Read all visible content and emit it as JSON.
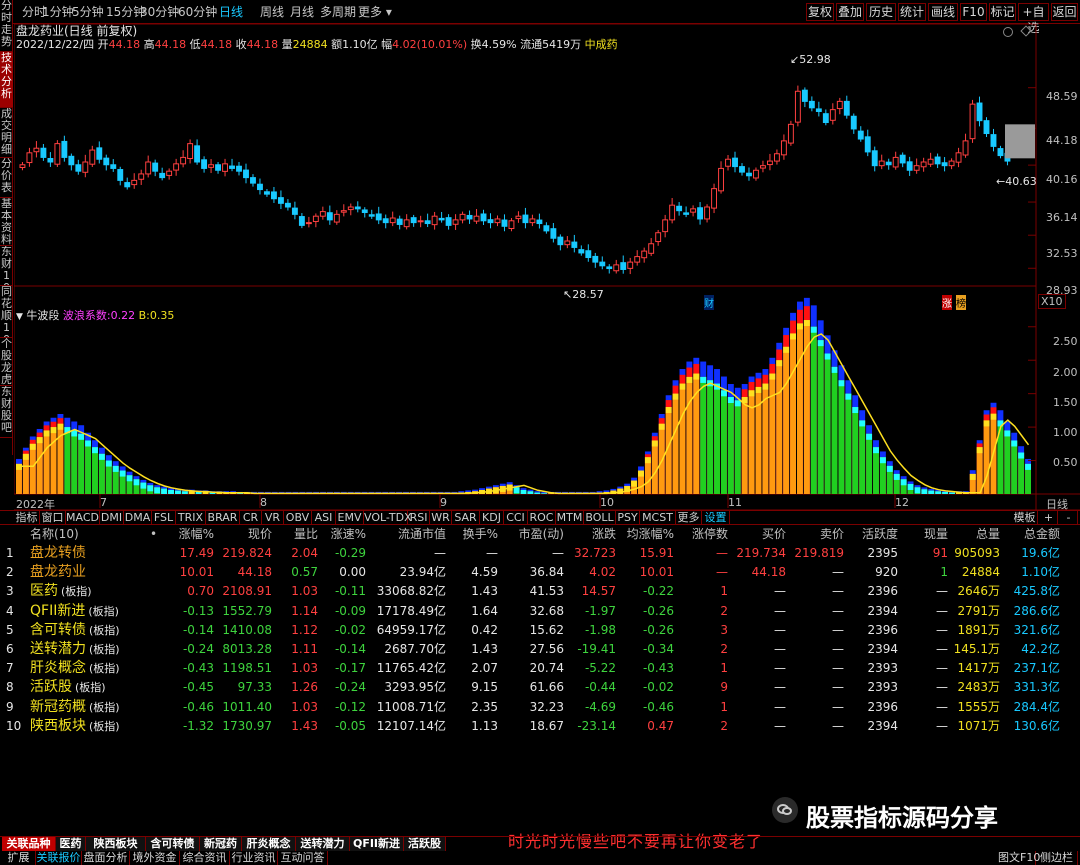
{
  "toolbar": {
    "periods": [
      "分时",
      "1分钟",
      "5分钟",
      "15分钟",
      "30分钟",
      "60分钟",
      "日线",
      "周线",
      "月线",
      "多周期",
      "更多"
    ],
    "active_period": "日线",
    "buttons": [
      "复权",
      "叠加",
      "历史",
      "统计",
      "画线",
      "F10",
      "标记",
      "+自选",
      "返回"
    ]
  },
  "sidebar": {
    "tabs": [
      "分时走势",
      "技术分析",
      "成交明细",
      "分价表",
      "基本资料",
      "东财10",
      "同花顺10",
      "个股龙虎",
      "东财股吧"
    ],
    "active": "技术分析"
  },
  "header": {
    "title": "盘龙药业(日线 前复权)",
    "date": "2022/12/22/四",
    "open_label": "开",
    "open": "44.18",
    "high_label": "高",
    "high": "44.18",
    "low_label": "低",
    "low": "44.18",
    "close_label": "收",
    "close": "44.18",
    "vol_label": "量",
    "vol": "24884",
    "amount_label": "额",
    "amount": "1.10亿",
    "change_label": "幅",
    "change": "4.02(10.01%)",
    "turnover_label": "换",
    "turnover": "4.59%",
    "float_label": "流通",
    "float": "5419万",
    "sector": "中成药"
  },
  "indicator_header": {
    "name": "牛波段",
    "coef_label": "波浪系数:",
    "coef": "0.22",
    "b_label": "B:",
    "b": "0.35"
  },
  "axis": {
    "x_year": "2022年",
    "x_months": [
      "7",
      "8",
      "9",
      "10",
      "11",
      "12"
    ],
    "x_right": "日线",
    "price_ticks": [
      "48.59",
      "44.18",
      "40.16",
      "36.14",
      "32.53",
      "28.93"
    ],
    "ind_ticks": [
      "2.50",
      "2.00",
      "1.50",
      "1.00",
      "0.50"
    ],
    "marks": {
      "max": "52.98",
      "min": "28.57",
      "last": "40.63",
      "cai": "财",
      "zhang": "涨",
      "bang": "榜",
      "x10": "X10"
    }
  },
  "indicator_tabs": [
    "指标",
    "窗口",
    "MACD",
    "DMI",
    "DMA",
    "FSL",
    "TRIX",
    "BRAR",
    "CR",
    "VR",
    "OBV",
    "ASI",
    "EMV",
    "VOL-TDX",
    "RSI",
    "WR",
    "SAR",
    "KDJ",
    "CCI",
    "ROC",
    "MTM",
    "BOLL",
    "PSY",
    "MCST",
    "更多",
    "设置"
  ],
  "indicator_tabs_right": [
    "模板",
    "+",
    "-"
  ],
  "table": {
    "headers": [
      "",
      "名称(10)",
      "•",
      "涨幅%",
      "现价",
      "量比",
      "涨速%",
      "流通市值",
      "换手%",
      "市盈(动)",
      "涨跌",
      "均涨幅%",
      "涨停数",
      "买价",
      "卖价",
      "活跃度",
      "现量",
      "总量",
      "总金额"
    ],
    "rows": [
      {
        "idx": "1",
        "name": "盘龙转债",
        "tag": "",
        "chg": "17.49",
        "price": "219.824",
        "lb": "2.04",
        "zs": "-0.29",
        "ltsz": "—",
        "hs": "—",
        "syl": "—",
        "zd": "32.723",
        "jzf": "15.91",
        "zts": "—",
        "buy": "219.734",
        "sell": "219.819",
        "hyd": "2395",
        "xl": "91",
        "zl": "905093",
        "zje": "19.6亿"
      },
      {
        "idx": "2",
        "name": "盘龙药业",
        "tag": "",
        "chg": "10.01",
        "price": "44.18",
        "lb": "0.57",
        "zs": "0.00",
        "ltsz": "23.94亿",
        "hs": "4.59",
        "syl": "36.84",
        "zd": "4.02",
        "jzf": "10.01",
        "zts": "—",
        "buy": "44.18",
        "sell": "—",
        "hyd": "920",
        "xl": "1",
        "zl": "24884",
        "zje": "1.10亿"
      },
      {
        "idx": "3",
        "name": "医药",
        "tag": "(板指)",
        "chg": "0.70",
        "price": "2108.91",
        "lb": "1.03",
        "zs": "-0.11",
        "ltsz": "33068.82亿",
        "hs": "1.43",
        "syl": "41.53",
        "zd": "14.57",
        "jzf": "-0.22",
        "zts": "1",
        "buy": "—",
        "sell": "—",
        "hyd": "2396",
        "xl": "—",
        "zl": "2646万",
        "zje": "425.8亿"
      },
      {
        "idx": "4",
        "name": "QFII新进",
        "tag": "(板指)",
        "chg": "-0.13",
        "price": "1552.79",
        "lb": "1.14",
        "zs": "-0.09",
        "ltsz": "17178.49亿",
        "hs": "1.64",
        "syl": "32.68",
        "zd": "-1.97",
        "jzf": "-0.26",
        "zts": "2",
        "buy": "—",
        "sell": "—",
        "hyd": "2394",
        "xl": "—",
        "zl": "2791万",
        "zje": "286.6亿"
      },
      {
        "idx": "5",
        "name": "含可转债",
        "tag": "(板指)",
        "chg": "-0.14",
        "price": "1410.08",
        "lb": "1.12",
        "zs": "-0.02",
        "ltsz": "64959.17亿",
        "hs": "0.42",
        "syl": "15.62",
        "zd": "-1.98",
        "jzf": "-0.26",
        "zts": "3",
        "buy": "—",
        "sell": "—",
        "hyd": "2396",
        "xl": "—",
        "zl": "1891万",
        "zje": "321.6亿"
      },
      {
        "idx": "6",
        "name": "送转潜力",
        "tag": "(板指)",
        "chg": "-0.24",
        "price": "8013.28",
        "lb": "1.11",
        "zs": "-0.14",
        "ltsz": "2687.70亿",
        "hs": "1.43",
        "syl": "27.56",
        "zd": "-19.41",
        "jzf": "-0.34",
        "zts": "2",
        "buy": "—",
        "sell": "—",
        "hyd": "2394",
        "xl": "—",
        "zl": "145.1万",
        "zje": "42.2亿"
      },
      {
        "idx": "7",
        "name": "肝炎概念",
        "tag": "(板指)",
        "chg": "-0.43",
        "price": "1198.51",
        "lb": "1.03",
        "zs": "-0.17",
        "ltsz": "11765.42亿",
        "hs": "2.07",
        "syl": "20.74",
        "zd": "-5.22",
        "jzf": "-0.43",
        "zts": "1",
        "buy": "—",
        "sell": "—",
        "hyd": "2393",
        "xl": "—",
        "zl": "1417万",
        "zje": "237.1亿"
      },
      {
        "idx": "8",
        "name": "活跃股",
        "tag": "(板指)",
        "chg": "-0.45",
        "price": "97.33",
        "lb": "1.26",
        "zs": "-0.24",
        "ltsz": "3293.95亿",
        "hs": "9.15",
        "syl": "61.66",
        "zd": "-0.44",
        "jzf": "-0.02",
        "zts": "9",
        "buy": "—",
        "sell": "—",
        "hyd": "2393",
        "xl": "—",
        "zl": "2483万",
        "zje": "331.3亿"
      },
      {
        "idx": "9",
        "name": "新冠药概",
        "tag": "(板指)",
        "chg": "-0.46",
        "price": "1011.40",
        "lb": "1.03",
        "zs": "-0.12",
        "ltsz": "11008.71亿",
        "hs": "2.35",
        "syl": "32.23",
        "zd": "-4.69",
        "jzf": "-0.46",
        "zts": "1",
        "buy": "—",
        "sell": "—",
        "hyd": "2396",
        "xl": "—",
        "zl": "1555万",
        "zje": "284.4亿"
      },
      {
        "idx": "10",
        "name": "陕西板块",
        "tag": "(板指)",
        "chg": "-1.32",
        "price": "1730.97",
        "lb": "1.43",
        "zs": "-0.05",
        "ltsz": "12107.14亿",
        "hs": "1.13",
        "syl": "18.67",
        "zd": "-23.14",
        "jzf": "0.47",
        "zts": "2",
        "buy": "—",
        "sell": "—",
        "hyd": "2394",
        "xl": "—",
        "zl": "1071万",
        "zje": "130.6亿"
      }
    ]
  },
  "bottom_tabs": [
    "关联品种",
    "医药",
    "陕西板块",
    "含可转债",
    "新冠药",
    "肝炎概念",
    "送转潜力",
    "QFII新进",
    "活跃股"
  ],
  "bottom_tabs_active": "关联品种",
  "bottom_tabs2": [
    "扩展",
    "关联报价",
    "盘面分析",
    "境外资金",
    "综合资讯",
    "行业资讯",
    "互动问答"
  ],
  "bottom_tabs2_right": [
    "图文F10",
    "侧边栏"
  ],
  "watermark": {
    "brand": "股票指标源码分享",
    "slogan": "时光时光慢些吧不要再让你变老了"
  },
  "colors": {
    "up": "#ff4040",
    "down": "#19c9ff",
    "bg": "#000000",
    "border": "#7a0000"
  },
  "chart_data": [
    {
      "type": "candlestick",
      "title": "盘龙药业(日线 前复权)",
      "y_ticks": [
        48.59,
        44.18,
        40.16,
        36.14,
        32.53,
        28.93
      ],
      "ylim": [
        27.0,
        54.0
      ],
      "x_labels": [
        "2022年",
        "7",
        "8",
        "9",
        "10",
        "11",
        "12"
      ],
      "annotations": {
        "max": 52.98,
        "min": 28.57,
        "last": 40.63
      },
      "close_series": [
        40.2,
        41.5,
        42.0,
        41.0,
        40.5,
        42.5,
        41.0,
        40.2,
        39.5,
        40.5,
        41.8,
        40.8,
        40.2,
        39.8,
        38.5,
        37.8,
        38.5,
        39.2,
        40.5,
        39.5,
        38.8,
        39.5,
        40.3,
        41.0,
        42.5,
        40.5,
        39.8,
        40.2,
        39.6,
        40.3,
        39.8,
        39.5,
        38.8,
        38.2,
        37.5,
        37.0,
        36.5,
        36.0,
        35.6,
        34.8,
        33.6,
        33.9,
        34.6,
        35.1,
        34.2,
        34.8,
        35.2,
        35.6,
        35.4,
        35.0,
        34.6,
        34.2,
        33.9,
        34.4,
        33.7,
        34.2,
        33.9,
        34.1,
        33.8,
        34.6,
        34.2,
        33.6,
        34.2,
        34.8,
        34.3,
        34.6,
        34.1,
        33.9,
        34.3,
        33.5,
        34.1,
        34.6,
        33.9,
        34.3,
        33.8,
        33.0,
        32.2,
        31.5,
        31.9,
        31.2,
        30.6,
        30.1,
        29.6,
        29.2,
        28.9,
        29.3,
        28.8,
        29.6,
        30.2,
        30.8,
        31.6,
        32.8,
        34.2,
        35.8,
        35.2,
        34.8,
        35.4,
        34.3,
        35.6,
        37.6,
        39.8,
        40.8,
        40.0,
        39.4,
        39.0,
        39.6,
        40.1,
        40.6,
        41.4,
        42.8,
        44.6,
        48.2,
        47.1,
        46.4,
        46.0,
        44.8,
        46.2,
        47.1,
        45.6,
        44.1,
        43.0,
        41.6,
        40.1,
        40.6,
        40.2,
        41.0,
        40.4,
        39.6,
        40.1,
        40.5,
        40.8,
        40.3,
        40.1,
        40.6,
        41.5,
        42.8,
        46.8,
        45.0,
        43.6,
        42.2,
        41.2,
        40.6
      ],
      "volume_note": "indicator 牛波段 (coef 0.22, B 0.35)"
    },
    {
      "type": "bar",
      "title": "牛波段",
      "y_ticks": [
        2.5,
        2.0,
        1.5,
        1.0,
        0.5
      ],
      "ylim": [
        0,
        2.9
      ],
      "series": [
        {
          "name": "波浪系数",
          "values": [
            0.22
          ]
        },
        {
          "name": "B",
          "values": [
            0.35
          ]
        }
      ],
      "ind_series": [
        0.45,
        0.6,
        0.75,
        0.85,
        0.95,
        1.0,
        1.05,
        1.0,
        0.95,
        0.9,
        0.8,
        0.7,
        0.6,
        0.5,
        0.42,
        0.35,
        0.28,
        0.22,
        0.17,
        0.13,
        0.1,
        0.08,
        0.06,
        0.05,
        0.04,
        0.04,
        0.03,
        0.03,
        0.02,
        0.02,
        0.02,
        0.02,
        0.01,
        0.01,
        0.01,
        0.01,
        0.01,
        0.01,
        0.01,
        0.01,
        0.01,
        0.01,
        0.01,
        0.01,
        0.01,
        0.01,
        0.01,
        0.01,
        0.01,
        0.01,
        0.01,
        0.01,
        0.01,
        0.01,
        0.01,
        0.01,
        0.01,
        0.01,
        0.01,
        0.01,
        0.01,
        0.01,
        0.01,
        0.01,
        0.02,
        0.03,
        0.04,
        0.06,
        0.08,
        0.1,
        0.12,
        0.14,
        0.1,
        0.06,
        0.04,
        0.02,
        0.01,
        0.01,
        0.01,
        0.01,
        0.01,
        0.01,
        0.01,
        0.01,
        0.02,
        0.03,
        0.05,
        0.08,
        0.12,
        0.2,
        0.35,
        0.55,
        0.8,
        1.05,
        1.3,
        1.5,
        1.65,
        1.75,
        1.8,
        1.75,
        1.7,
        1.65,
        1.55,
        1.45,
        1.4,
        1.45,
        1.55,
        1.6,
        1.65,
        1.8,
        2.0,
        2.2,
        2.4,
        2.55,
        2.6,
        2.5,
        2.3,
        2.1,
        1.9,
        1.7,
        1.5,
        1.3,
        1.1,
        0.9,
        0.7,
        0.55,
        0.42,
        0.3,
        0.22,
        0.15,
        0.1,
        0.07,
        0.05,
        0.04,
        0.03,
        0.02,
        0.02,
        0.02,
        0.3,
        0.7,
        1.1,
        1.2,
        1.1,
        0.95,
        0.8,
        0.62,
        0.45
      ]
    }
  ]
}
